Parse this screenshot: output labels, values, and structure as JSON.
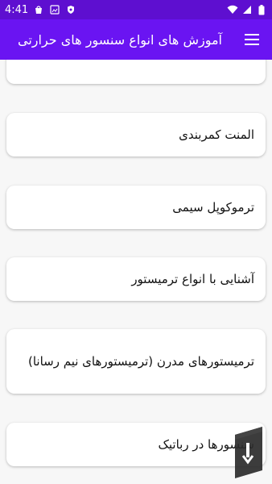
{
  "status_bar": {
    "time": "4:41",
    "icons": [
      "bag-icon",
      "image-icon",
      "shield-icon"
    ],
    "right_icons": [
      "wifi-icon",
      "signal-icon",
      "battery-icon"
    ]
  },
  "app_bar": {
    "title": "آموزش های انواع سنسور های حرارتی",
    "menu_icon": "hamburger-menu-icon"
  },
  "items": [
    {
      "label": ""
    },
    {
      "label": "المنت کمربندی"
    },
    {
      "label": "ترموکوپل سیمی"
    },
    {
      "label": "آشنایی با انواع ترمیستور"
    },
    {
      "label": "ترمیستورهای مدرن (ترمیستورهای نیم رسانا)"
    },
    {
      "label": "سنسورها در رباتیک"
    }
  ],
  "colors": {
    "status_bar": "#5e0fd0",
    "app_bar": "#6a14f2",
    "background": "#f7f7f7",
    "card": "#ffffff"
  }
}
